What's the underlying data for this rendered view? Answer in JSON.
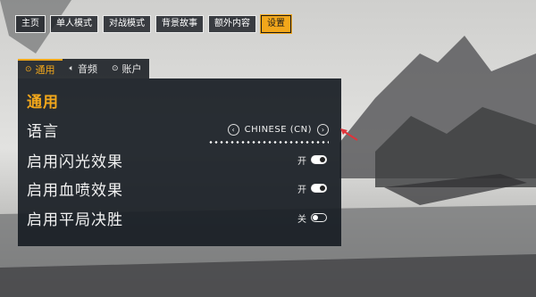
{
  "nav": {
    "items": [
      {
        "label": "主页",
        "active": false
      },
      {
        "label": "单人模式",
        "active": false
      },
      {
        "label": "对战模式",
        "active": false
      },
      {
        "label": "背景故事",
        "active": false
      },
      {
        "label": "额外内容",
        "active": false
      },
      {
        "label": "设置",
        "active": true
      }
    ]
  },
  "subtabs": [
    {
      "icon": "gear-icon",
      "glyph": "⊙",
      "label": "通用",
      "active": true
    },
    {
      "icon": "speaker-icon",
      "glyph": "🔈︎",
      "label": "音频",
      "active": false
    },
    {
      "icon": "account-icon",
      "glyph": "⊙",
      "label": "账户",
      "active": false
    }
  ],
  "panel": {
    "title": "通用",
    "language": {
      "label": "语言",
      "value": "CHINESE (CN)",
      "prev_glyph": "‹",
      "next_glyph": "›"
    },
    "flash": {
      "label": "启用闪光效果",
      "state": "开"
    },
    "blood": {
      "label": "启用血喷效果",
      "state": "开"
    },
    "draw": {
      "label": "启用平局决胜",
      "state": "关"
    }
  },
  "colors": {
    "accent": "#f2a71b",
    "panel": "#181d24",
    "annotation": "#e0343a"
  }
}
